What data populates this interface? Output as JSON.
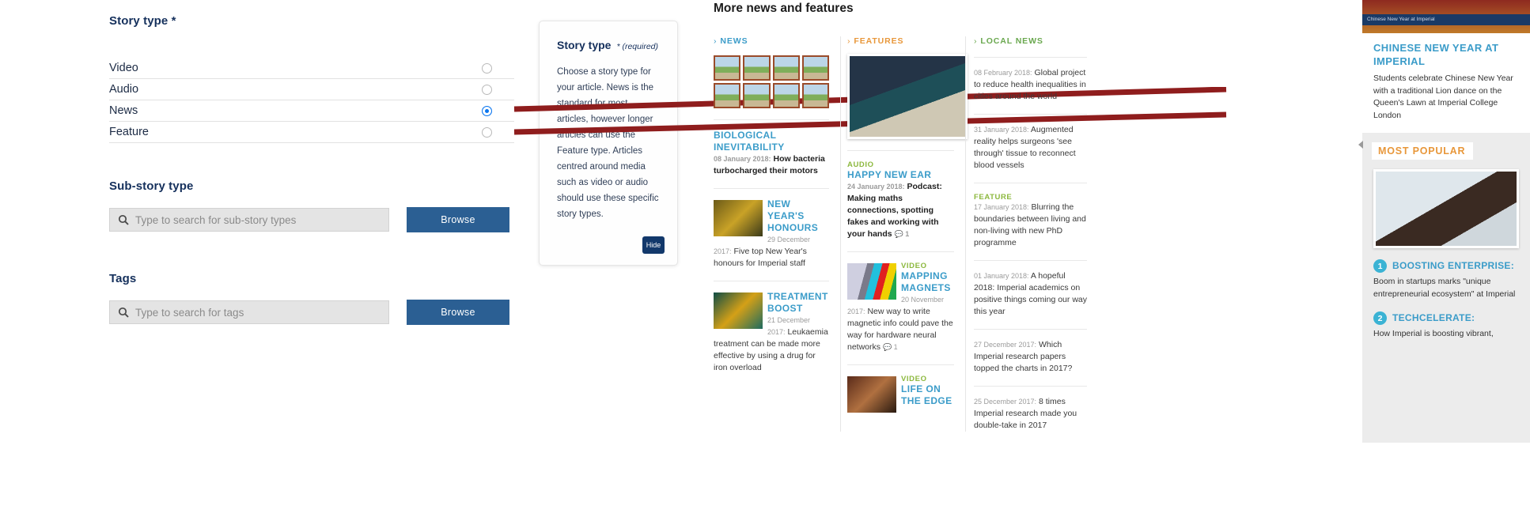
{
  "form": {
    "story_type_label": "Story type *",
    "options": [
      {
        "label": "Video",
        "selected": false
      },
      {
        "label": "Audio",
        "selected": false
      },
      {
        "label": "News",
        "selected": true
      },
      {
        "label": "Feature",
        "selected": false
      }
    ],
    "sub_story_label": "Sub-story type",
    "sub_story_placeholder": "Type to search for sub-story types",
    "sub_story_value": "",
    "tags_label": "Tags",
    "tags_placeholder": "Type to search for tags",
    "tags_value": "",
    "browse_label": "Browse",
    "search_icon": "magnifier-icon"
  },
  "tooltip": {
    "title": "Story type",
    "required_note": "* (required)",
    "body": "Choose a story type for your article. News is the standard for most articles, however longer articles can use the Feature type. Articles centred around media such as video or audio should use these specific story types.",
    "hide_label": "Hide"
  },
  "news": {
    "heading": "More news and features",
    "columns": [
      {
        "category": "NEWS",
        "accent": "#3b9cc9",
        "articles": [
          {
            "kicker": "BIOLOGICAL INEVITABILITY",
            "date": "08 January 2018:",
            "text": "How bacteria turbocharged their motors",
            "thumb": "",
            "comments": ""
          },
          {
            "kicker": "NEW YEAR'S HONOURS",
            "date": "29 December 2017:",
            "text": "Five top New Year's honours for Imperial staff",
            "thumb": "th-gold",
            "comments": ""
          },
          {
            "kicker": "TREATMENT BOOST",
            "date": "21 December 2017:",
            "text": "Leukaemia treatment can be made more effective by using a drug for iron overload",
            "thumb": "th-teal",
            "comments": ""
          }
        ]
      },
      {
        "category": "FEATURES",
        "accent": "#e8973a",
        "articles": [
          {
            "sub_kicker": "AUDIO",
            "kicker": "HAPPY NEW EAR",
            "date": "24 January 2018:",
            "text": "Podcast: Making maths connections, spotting fakes and working with your hands",
            "comments": "1"
          },
          {
            "sub_kicker": "VIDEO",
            "kicker": "MAPPING MAGNETS",
            "date": "20 November 2017:",
            "text": "New way to write magnetic info could pave the way for hardware neural networks",
            "thumb": "th-mag",
            "comments": "1"
          },
          {
            "sub_kicker": "VIDEO",
            "kicker": "LIFE ON THE EDGE",
            "date": "",
            "text": "",
            "thumb": "th-life",
            "comments": ""
          }
        ]
      },
      {
        "category": "LOCAL NEWS",
        "accent": "#6aa84f",
        "articles": [
          {
            "date": "08 February 2018:",
            "text": "Global project to reduce health inequalities in cities around the world"
          },
          {
            "date": "31 January 2018:",
            "text": "Augmented reality helps surgeons 'see through' tissue to reconnect blood vessels"
          },
          {
            "sub_kicker": "FEATURE",
            "date": "17 January 2018:",
            "text": "Blurring the boundaries between living and non-living with new PhD programme"
          },
          {
            "date": "01 January 2018:",
            "text": "A hopeful 2018: Imperial academics on positive things coming our way this year"
          },
          {
            "date": "27 December 2017:",
            "text": "Which Imperial research papers topped the charts in 2017?"
          },
          {
            "date": "25 December 2017:",
            "text": "8 times Imperial research made you double-take in 2017"
          }
        ]
      }
    ]
  },
  "sidebar": {
    "image_caption": "Chinese New Year at Imperial",
    "feature_title": "CHINESE NEW YEAR AT IMPERIAL",
    "feature_text": "Students celebrate Chinese New Year with a traditional Lion dance on the Queen's Lawn at Imperial College London",
    "most_popular_label": "MOST POPULAR",
    "items": [
      {
        "num": "1",
        "title": "BOOSTING ENTERPRISE:",
        "text": "Boom in startups marks \"unique entrepreneurial ecosystem\" at Imperial"
      },
      {
        "num": "2",
        "title": "TECHCELERATE:",
        "text": "How Imperial is boosting vibrant,"
      }
    ]
  },
  "annotations": {
    "arrow_color": "#8f1d1d",
    "count": 2
  }
}
